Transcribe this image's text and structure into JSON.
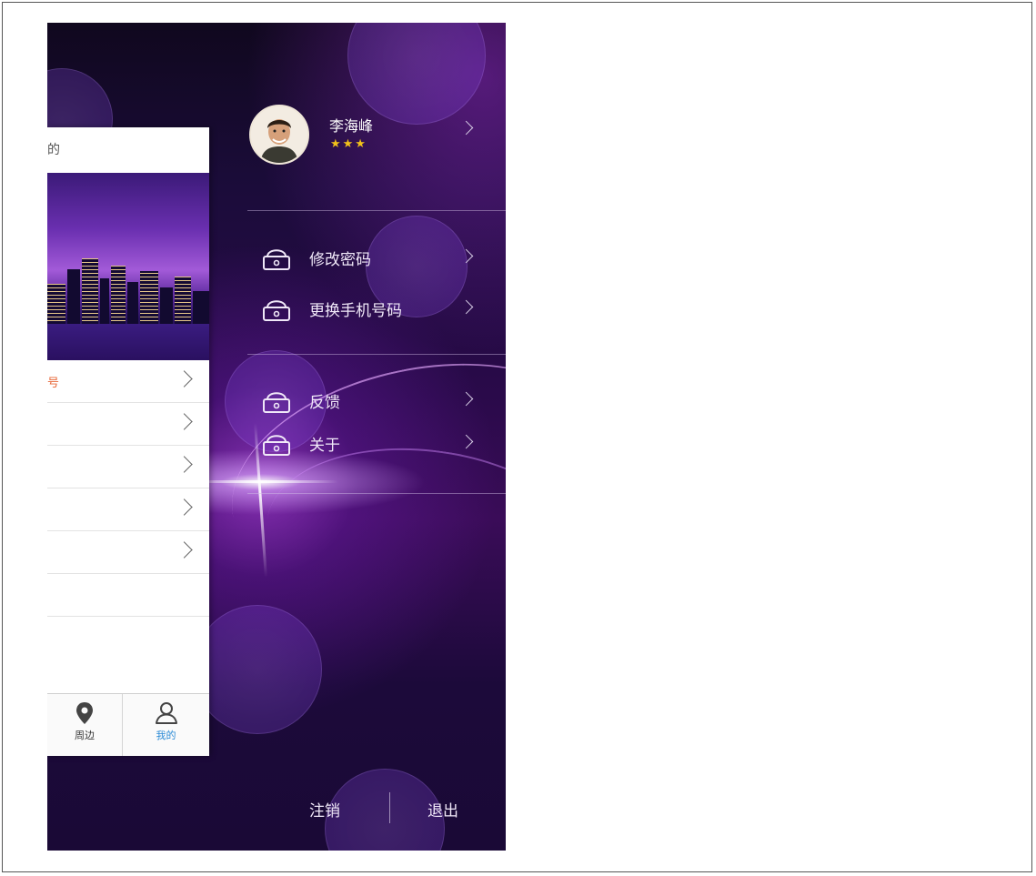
{
  "card": {
    "header_text": "的",
    "rows": [
      {
        "text": "号"
      },
      {
        "text": ""
      },
      {
        "text": ""
      },
      {
        "text": ""
      },
      {
        "text": ""
      },
      {
        "text": ""
      }
    ],
    "tabs": [
      {
        "label": "周边",
        "icon": "location-pin-icon",
        "active": false
      },
      {
        "label": "我的",
        "icon": "user-icon",
        "active": true
      }
    ]
  },
  "profile": {
    "name": "李海峰",
    "stars": "★★★"
  },
  "menu": {
    "items": [
      {
        "label": "修改密码",
        "icon": "lock-icon"
      },
      {
        "label": "更换手机号码",
        "icon": "lock-icon"
      },
      {
        "label": "反馈",
        "icon": "lock-icon"
      },
      {
        "label": "关于",
        "icon": "lock-icon"
      }
    ]
  },
  "footer": {
    "logout_label": "注销",
    "exit_label": "退出"
  },
  "colors": {
    "accent_star": "#f2c21a",
    "active_tab": "#2a8ad6",
    "row_highlight": "#e8683a"
  }
}
